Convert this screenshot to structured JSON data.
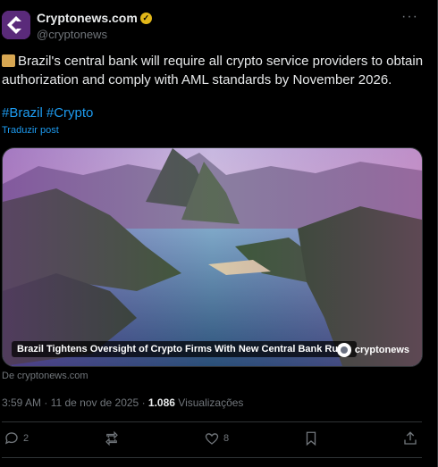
{
  "post": {
    "author_name": "Cryptonews.com",
    "handle": "@cryptonews",
    "text": "Brazil's central bank will require all crypto service providers to obtain authorization and comply with AML standards by November 2026.",
    "hashtags": [
      "#Brazil",
      "#Crypto"
    ],
    "translate_label": "Traduzir post",
    "media_caption": "Brazil Tightens Oversight of Crypto Firms With New Central Bank Rules",
    "media_brand": "cryptonews",
    "source_label": "De cryptonews.com",
    "time": "3:59 AM",
    "date": "11 de nov de 2025",
    "views_count": "1.086",
    "views_label": "Visualizações"
  },
  "actions": {
    "replies": "2",
    "reposts": "",
    "likes": "8"
  },
  "icons": [
    "verified-badge-icon",
    "more-icon",
    "scroll-emoji-icon",
    "reply-icon",
    "repost-icon",
    "like-icon",
    "bookmark-icon",
    "share-icon"
  ],
  "colors": {
    "link": "#1d9bf0",
    "badge": "#e2b719",
    "muted": "#71767b",
    "background": "#000000"
  }
}
